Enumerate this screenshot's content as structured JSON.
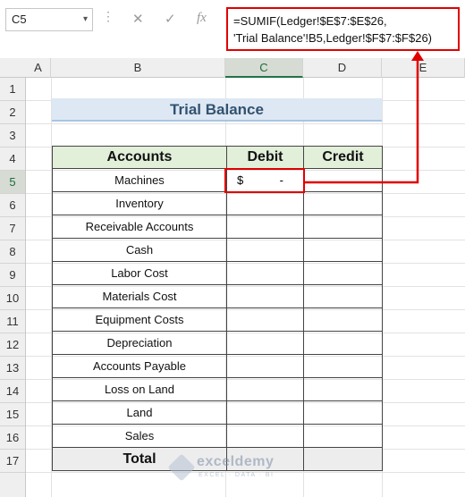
{
  "formula_bar": {
    "name_box": "C5",
    "formula_line1": "=SUMIF(Ledger!$E$7:$E$26,",
    "formula_line2": "'Trial Balance'!B5,Ledger!$F$7:$F$26)",
    "cancel_icon": "✕",
    "enter_icon": "✓",
    "fx_icon": "fx"
  },
  "columns": [
    "A",
    "B",
    "C",
    "D",
    "E"
  ],
  "rows": [
    "1",
    "2",
    "3",
    "4",
    "5",
    "6",
    "7",
    "8",
    "9",
    "10",
    "11",
    "12",
    "13",
    "14",
    "15",
    "16",
    "17"
  ],
  "sheet": {
    "title": "Trial Balance",
    "headers": {
      "accounts": "Accounts",
      "debit": "Debit",
      "credit": "Credit"
    },
    "accounts": [
      "Machines",
      "Inventory",
      "Receivable Accounts",
      "Cash",
      "Labor Cost",
      "Materials Cost",
      "Equipment Costs",
      "Depreciation",
      "Accounts Payable",
      "Loss on Land",
      "Land",
      "Sales"
    ],
    "c5_currency": "$",
    "c5_value": "-",
    "total_label": "Total"
  },
  "watermark": {
    "name": "exceldemy",
    "tagline": "EXCEL · DATA · BI"
  },
  "colors": {
    "highlight": "#e00000",
    "header_fill": "#e2efd9",
    "title_fill": "#dde8f4",
    "total_fill": "#ededed"
  }
}
